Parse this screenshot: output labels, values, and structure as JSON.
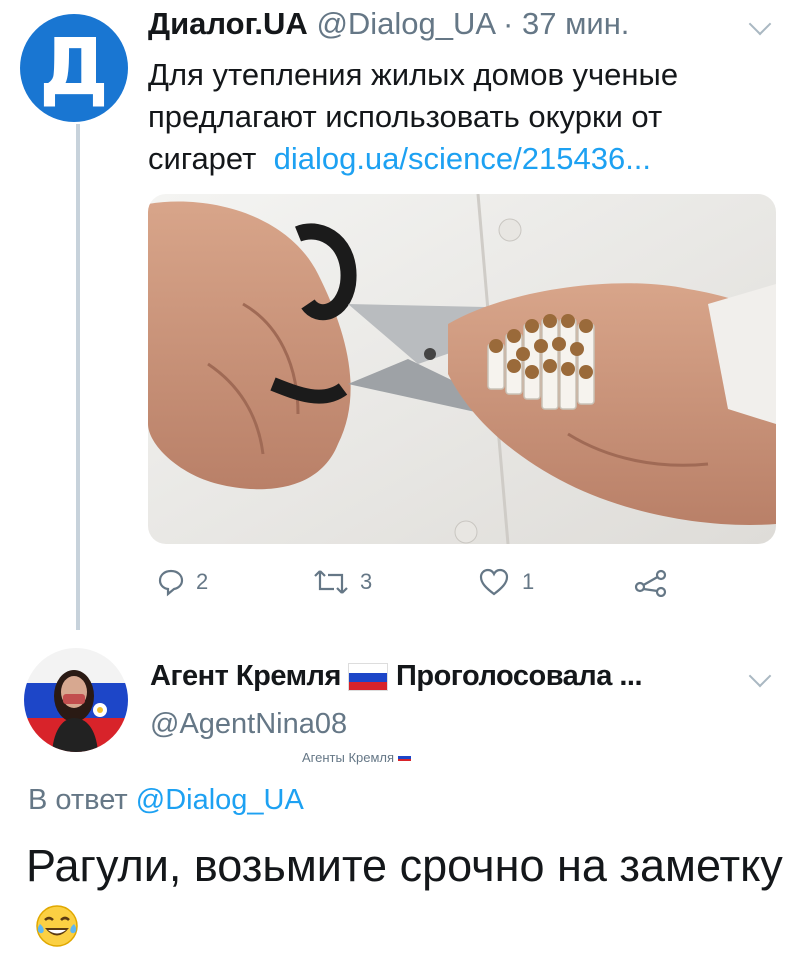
{
  "tweet1": {
    "avatar_letter": "Д",
    "display_name": "Диалог.UA",
    "handle": "@Dialog_UA",
    "separator": "·",
    "time": "37 мин.",
    "text": "Для утепления жилых домов ученые предлагают использовать окурки от сигарет",
    "link": "dialog.ua/science/215436...",
    "media_description": "hands cutting cigarettes with scissors",
    "actions": {
      "reply_count": "2",
      "retweet_count": "3",
      "like_count": "1"
    }
  },
  "tweet2": {
    "display_name": "Агент Кремля",
    "display_name_suffix": "Проголосовала ...",
    "handle": "@AgentNina08",
    "list_label": "Агенты Кремля",
    "reply_prefix": "В ответ",
    "reply_to": "@Dialog_UA",
    "text": "Рагули, возьмите срочно на заметку",
    "emoji_name": "face-with-tears-of-joy"
  },
  "colors": {
    "brand_blue": "#1976d2",
    "link": "#1da1f2",
    "muted": "#657786",
    "thread_line": "#c7d2db",
    "text": "#14171a"
  }
}
